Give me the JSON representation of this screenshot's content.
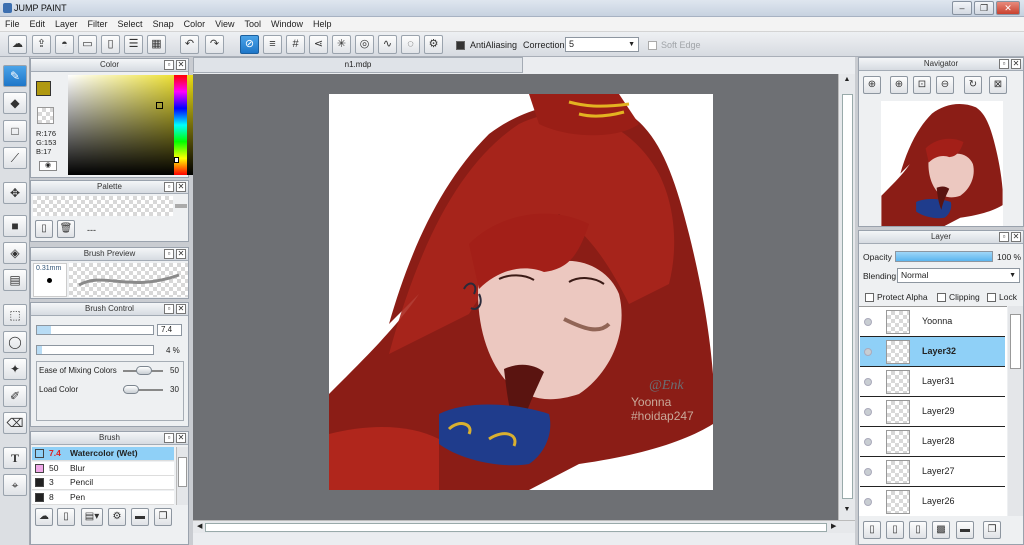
{
  "app": {
    "title": "JUMP PAINT"
  },
  "menu": [
    "File",
    "Edit",
    "Layer",
    "Filter",
    "Select",
    "Snap",
    "Color",
    "View",
    "Tool",
    "Window",
    "Help"
  ],
  "toolbar": {
    "antialias_label": "AntiAliasing",
    "correction_label": "Correction",
    "correction_value": "5",
    "soft_edge_label": "Soft Edge"
  },
  "color_panel": {
    "title": "Color",
    "r": "R:176",
    "g": "G:153",
    "b": "B:17",
    "fg_color": "#b09911"
  },
  "palette_panel": {
    "title": "Palette",
    "dash": "---"
  },
  "brush_preview": {
    "title": "Brush Preview",
    "size": "0.31mm"
  },
  "brush_control": {
    "title": "Brush Control",
    "size_value": "7.4",
    "opacity_value": "4 %",
    "opacity_level": 0.04,
    "mixing_label": "Ease of Mixing Colors",
    "mixing_value": "50",
    "load_label": "Load Color",
    "load_value": "30"
  },
  "brush_panel": {
    "title": "Brush",
    "items": [
      {
        "size": "7.4",
        "name": "Watercolor (Wet)",
        "color": "#8fd0f7",
        "selected": true
      },
      {
        "size": "50",
        "name": "Blur",
        "color": "#f0a8e8",
        "selected": false
      },
      {
        "size": "3",
        "name": "Pencil",
        "color": "#222222",
        "selected": false
      },
      {
        "size": "8",
        "name": "Pen",
        "color": "#222222",
        "selected": false
      }
    ]
  },
  "document": {
    "tab": "n1.mdp",
    "watermark1": "@Enk",
    "watermark2": "Yoonna",
    "watermark3": "#hoidap247"
  },
  "navigator": {
    "title": "Navigator"
  },
  "layer_panel": {
    "title": "Layer",
    "opacity_label": "Opacity",
    "opacity_value": "100 %",
    "blending_label": "Blending",
    "blending_value": "Normal",
    "protect_alpha": "Protect Alpha",
    "clipping": "Clipping",
    "lock": "Lock",
    "layers": [
      {
        "name": "Yoonna",
        "selected": false
      },
      {
        "name": "Layer32",
        "selected": true
      },
      {
        "name": "Layer31",
        "selected": false
      },
      {
        "name": "Layer29",
        "selected": false
      },
      {
        "name": "Layer28",
        "selected": false
      },
      {
        "name": "Layer27",
        "selected": false
      },
      {
        "name": "Layer26",
        "selected": false
      }
    ]
  }
}
